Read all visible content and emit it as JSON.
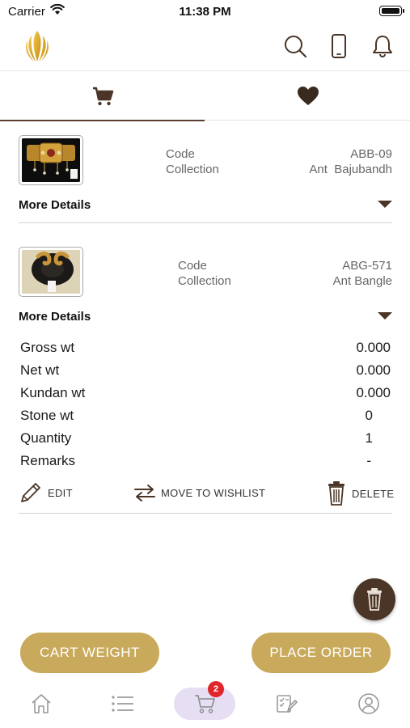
{
  "status_bar": {
    "carrier": "Carrier",
    "time": "11:38 PM"
  },
  "header": {
    "icons": [
      "logo-icon",
      "search-icon",
      "phone-icon",
      "bell-icon"
    ]
  },
  "tabs": [
    {
      "icon": "cart-icon",
      "active": true
    },
    {
      "icon": "heart-icon",
      "active": false
    }
  ],
  "items": [
    {
      "code_label": "Code",
      "code": "ABB-09",
      "collection_label": "Collection",
      "collection": "Ant  Bajubandh",
      "more_details": "More Details",
      "expanded": false
    },
    {
      "code_label": "Code",
      "code": "ABG-571",
      "collection_label": "Collection",
      "collection": "Ant Bangle",
      "more_details": "More Details",
      "expanded": true,
      "details": [
        {
          "label": "Gross wt",
          "value": "0.000"
        },
        {
          "label": "Net wt",
          "value": "0.000"
        },
        {
          "label": "Kundan wt",
          "value": "0.000"
        },
        {
          "label": "Stone wt",
          "value": "0"
        },
        {
          "label": "Quantity",
          "value": "1"
        },
        {
          "label": "Remarks",
          "value": "-"
        }
      ],
      "actions": {
        "edit": "EDIT",
        "move": "MOVE TO WISHLIST",
        "delete": "DELETE"
      }
    }
  ],
  "buttons": {
    "cart_weight": "CART WEIGHT",
    "place_order": "PLACE ORDER"
  },
  "bottom_nav": {
    "cart_badge": "2",
    "items": [
      "home-icon",
      "list-icon",
      "cart-icon",
      "checklist-icon",
      "profile-icon"
    ]
  },
  "colors": {
    "accent_gold": "#c9aa5c",
    "brown": "#4a3526",
    "badge_red": "#e0262b",
    "active_nav_bg": "#e6dff3"
  }
}
